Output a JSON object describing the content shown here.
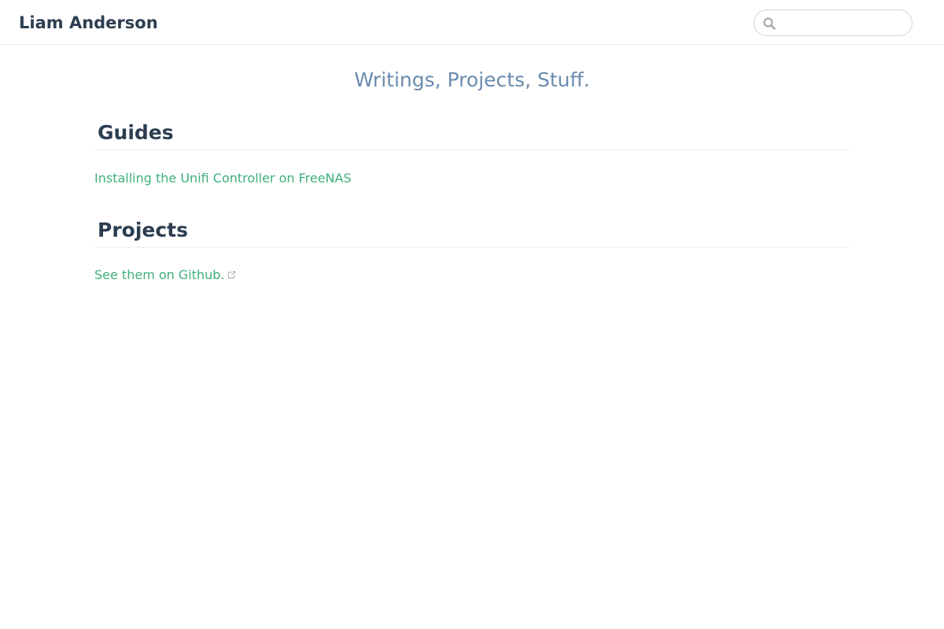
{
  "navbar": {
    "site_name": "Liam Anderson",
    "search": {
      "placeholder": "",
      "value": "",
      "icon": "search-icon"
    }
  },
  "main": {
    "tagline": "Writings, Projects, Stuff.",
    "sections": [
      {
        "heading": "Guides",
        "links": [
          {
            "label": "Installing the Unifi Controller on FreeNAS",
            "external": false
          }
        ]
      },
      {
        "heading": "Projects",
        "links": [
          {
            "label": "See them on Github.",
            "external": true,
            "icon": "external-link-icon"
          }
        ]
      }
    ]
  },
  "colors": {
    "accent": "#3eaf7c",
    "heading": "#2c3e50",
    "tagline": "#6a8bad",
    "border": "#eaecef",
    "muted_icon": "#aaaaaa"
  }
}
